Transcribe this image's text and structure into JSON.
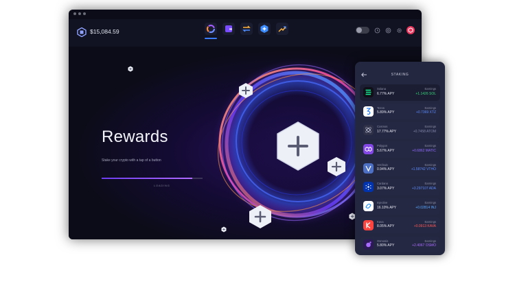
{
  "app": {
    "balance": "$15,084.59"
  },
  "rewards": {
    "title": "Rewards",
    "subtitle": "Stake your crypto with a tap of a button",
    "loading_label": "LOADING",
    "progress_fraction": 0.9
  },
  "staking": {
    "title": "STAKING",
    "rows": [
      {
        "name": "Solana",
        "apy": "6.77% APY",
        "earnings_label": "Earnings",
        "earnings": "+1.1426 SOL",
        "earnings_color": "#37d67a",
        "icon_bg": "#101018",
        "icon_color": "#14f195",
        "icon": "solana-icon"
      },
      {
        "name": "Tezos",
        "apy": "5.89% APY",
        "earnings_label": "Earnings",
        "earnings": "+0.7369 XTZ",
        "earnings_color": "#5b8cff",
        "icon_bg": "#ffffff",
        "icon_color": "#2c7df7",
        "icon": "tezos-icon"
      },
      {
        "name": "Cosmos",
        "apy": "17.77% APY",
        "earnings_label": "Earnings",
        "earnings": "+0.7458 ATOM",
        "earnings_color": "#7f84a8",
        "icon_bg": "#2e3148",
        "icon_color": "#b9bcd1",
        "icon": "cosmos-icon"
      },
      {
        "name": "Polygon",
        "apy": "5.67% APY",
        "earnings_label": "Earnings",
        "earnings": "+0.6862 MATIC",
        "earnings_color": "#8f6bff",
        "icon_bg": "#8247e5",
        "icon_color": "#ffffff",
        "icon": "polygon-icon"
      },
      {
        "name": "VeChain",
        "apy": "0.94% APY",
        "earnings_label": "Earnings",
        "earnings": "+1.58742 VTHO",
        "earnings_color": "#5b8cff",
        "icon_bg": "#4d6fc4",
        "icon_color": "#ffffff",
        "icon": "vechain-icon"
      },
      {
        "name": "Cardano",
        "apy": "3.07% APY",
        "earnings_label": "Earnings",
        "earnings": "+3.297107 ADA",
        "earnings_color": "#5b8cff",
        "icon_bg": "#0033ad",
        "icon_color": "#ffffff",
        "icon": "cardano-icon"
      },
      {
        "name": "Injective",
        "apy": "16.10% APY",
        "earnings_label": "Earnings",
        "earnings": "+0.02814 INJ",
        "earnings_color": "#5ba8ff",
        "icon_bg": "#ffffff",
        "icon_color": "#1a8dff",
        "icon": "injective-icon"
      },
      {
        "name": "Kava",
        "apy": "8.05% APY",
        "earnings_label": "Earnings",
        "earnings": "+0.0913 KAVA",
        "earnings_color": "#ff5a5a",
        "icon_bg": "#ff433e",
        "icon_color": "#ffffff",
        "icon": "kava-icon"
      },
      {
        "name": "Osmosis",
        "apy": "5.80% APY",
        "earnings_label": "Earnings",
        "earnings": "+2.4067 OSMO",
        "earnings_color": "#a86bff",
        "icon_bg": "#2b1a55",
        "icon_color": "#a86bff",
        "icon": "osmosis-icon"
      }
    ]
  },
  "colors": {
    "accent": "#6c3cf0",
    "panel_bg": "#242740"
  }
}
